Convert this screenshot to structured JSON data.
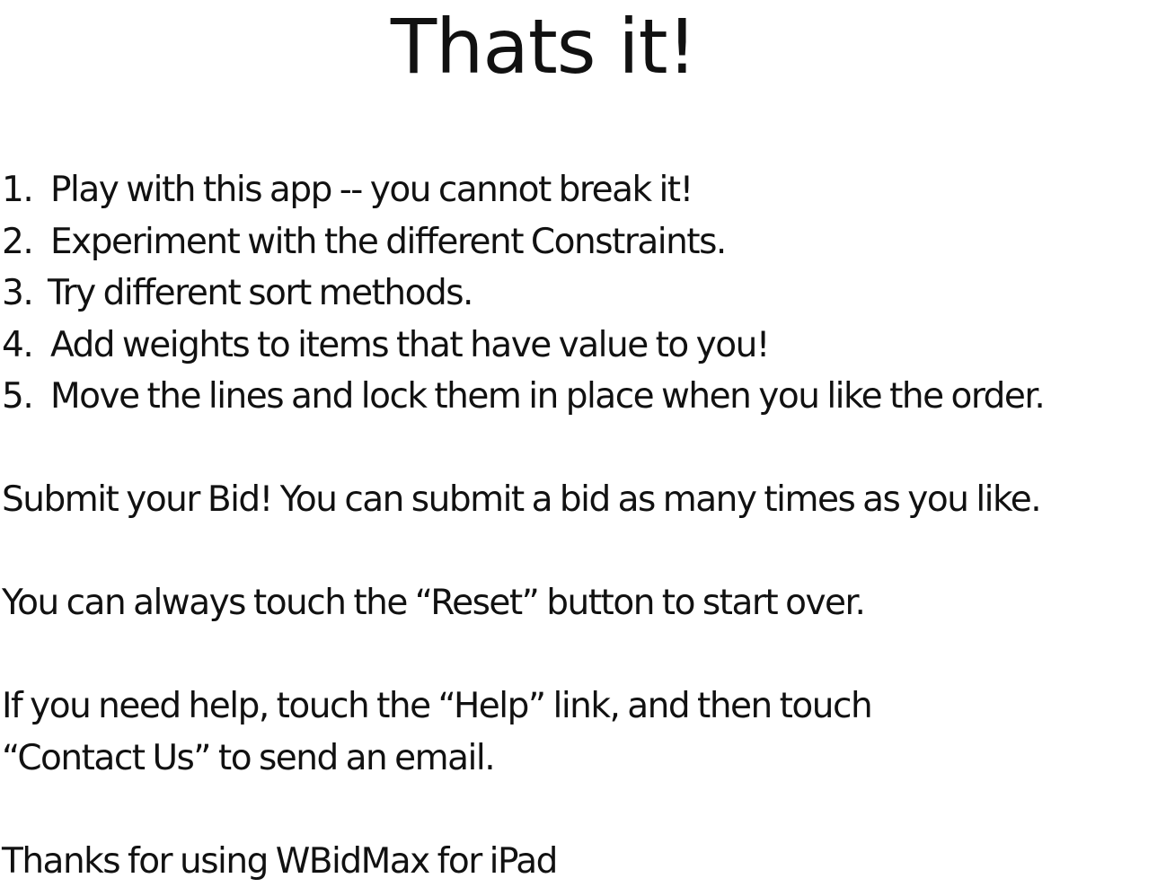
{
  "title": "Thats it!",
  "steps": [
    {
      "number": "1.",
      "text": "Play with this app -- you cannot break it!"
    },
    {
      "number": "2.",
      "text": "Experiment with the different Constraints."
    },
    {
      "number": "3.",
      "text": "Try different sort methods."
    },
    {
      "number": "4.",
      "text": "Add weights to items that have value to you!"
    },
    {
      "number": "5.",
      "text": "Move the lines and lock them in place when you like the order."
    }
  ],
  "submit_text": "Submit your Bid!  You can submit a bid as many times as you like.",
  "reset_text": "You can always touch the “Reset” button to start over.",
  "help_text_line1": "If you need help, touch the “Help” link, and then touch",
  "help_text_line2": "“Contact Us” to send an email.",
  "thanks_text": "Thanks for using WBidMax for iPad"
}
